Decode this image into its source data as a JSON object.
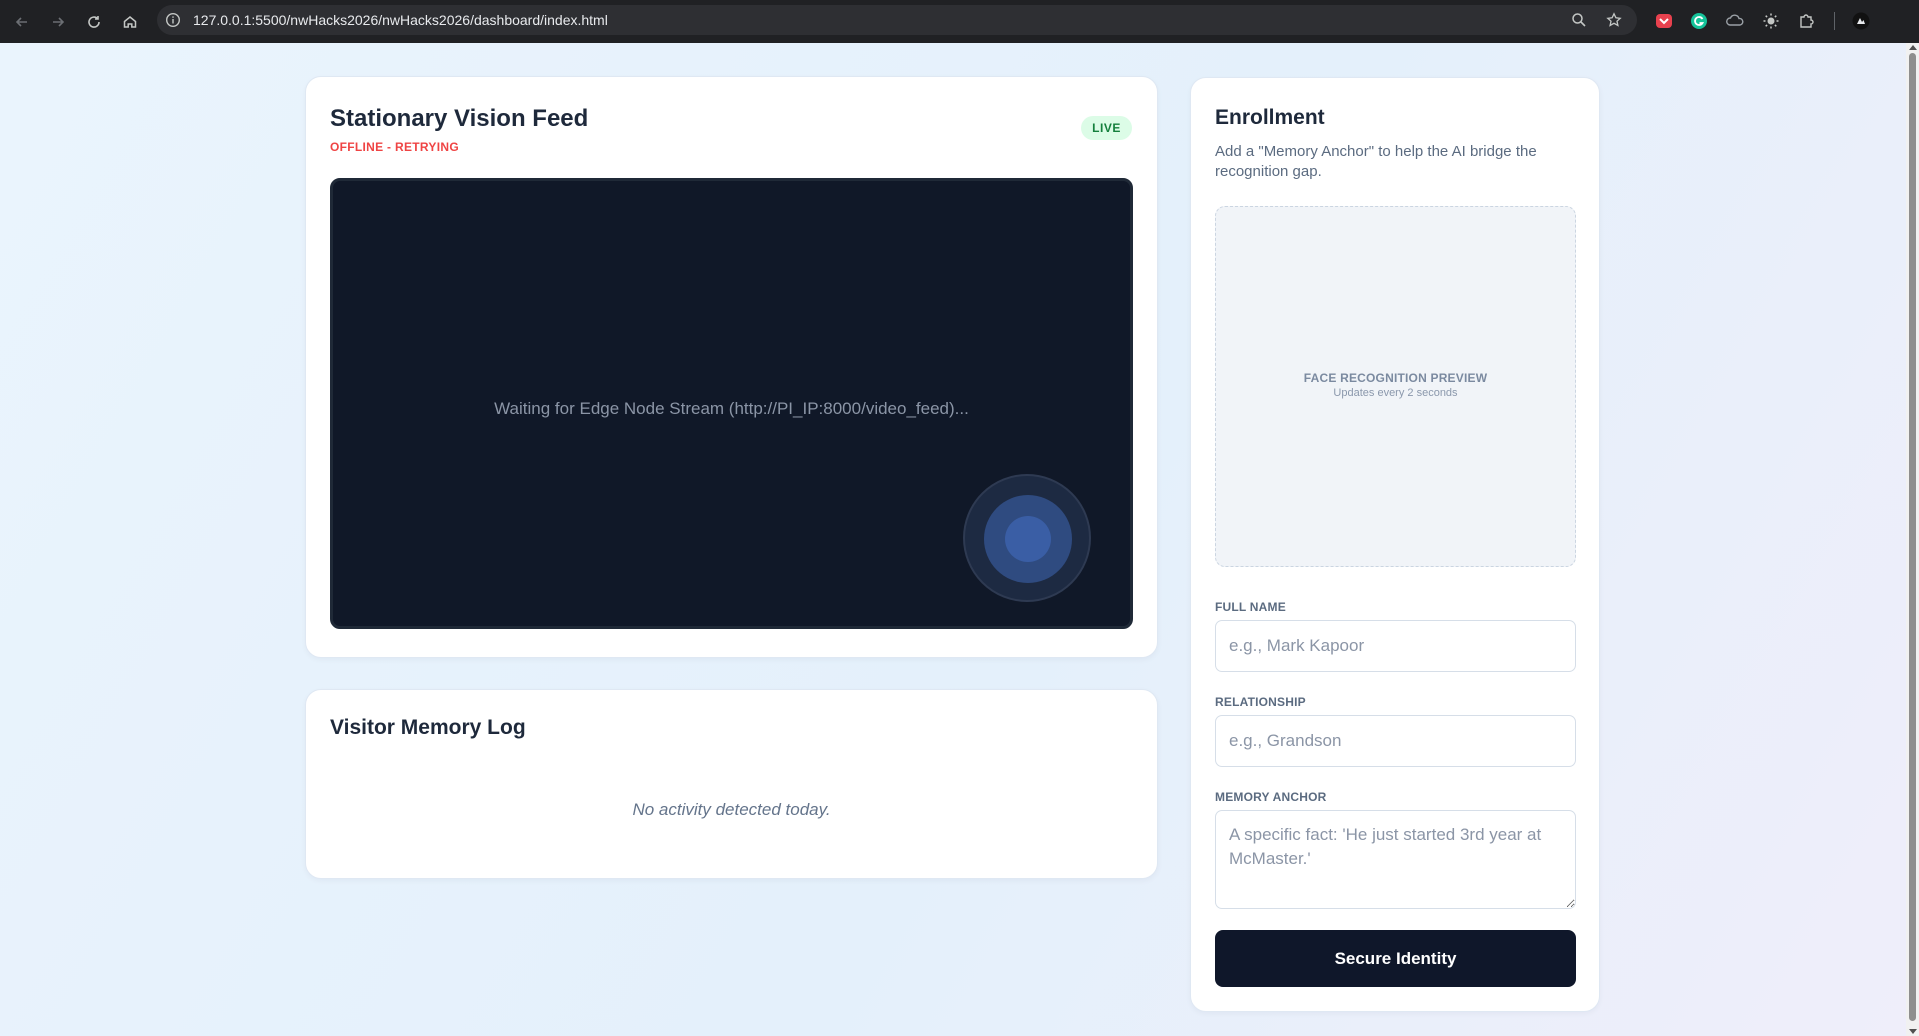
{
  "browser": {
    "url": "127.0.0.1:5500/nwHacks2026/nwHacks2026/dashboard/index.html"
  },
  "vision_feed": {
    "title": "Stationary Vision Feed",
    "status": "OFFLINE - RETRYING",
    "status_color": "#ef4444",
    "badge": "LIVE",
    "badge_color": "#15803d",
    "waiting_message": "Waiting for Edge Node Stream (http://PI_IP:8000/video_feed)..."
  },
  "visitor_log": {
    "title": "Visitor Memory Log",
    "empty_message": "No activity detected today."
  },
  "enrollment": {
    "title": "Enrollment",
    "description": "Add a \"Memory Anchor\" to help the AI bridge the recognition gap.",
    "preview_title": "FACE RECOGNITION PREVIEW",
    "preview_subtitle": "Updates every 2 seconds",
    "full_name_label": "FULL NAME",
    "full_name_placeholder": "e.g., Mark Kapoor",
    "relationship_label": "RELATIONSHIP",
    "relationship_placeholder": "e.g., Grandson",
    "memory_anchor_label": "MEMORY ANCHOR",
    "memory_anchor_placeholder": "A specific fact: 'He just started 3rd year at McMaster.'",
    "submit_label": "Secure Identity",
    "submit_color": "#0f172a"
  }
}
